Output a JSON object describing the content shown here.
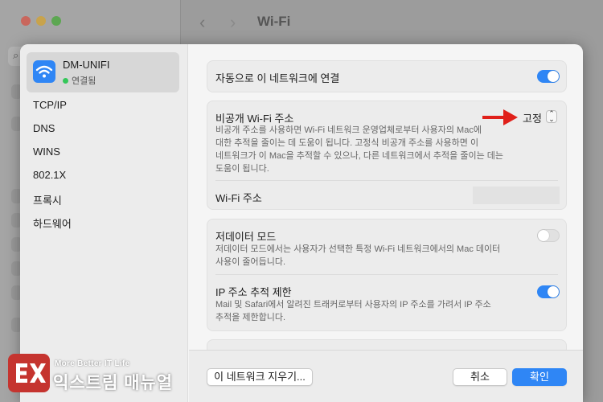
{
  "window": {
    "title": "Wi-Fi"
  },
  "sidebar": {
    "network": {
      "name": "DM-UNIFI",
      "status": "연결됨"
    },
    "items": [
      "TCP/IP",
      "DNS",
      "WINS",
      "802.1X",
      "프록시",
      "하드웨어"
    ]
  },
  "settings": {
    "auto_join": {
      "label": "자동으로 이 네트워크에 연결",
      "enabled": true
    },
    "private_address": {
      "label": "비공개 Wi-Fi 주소",
      "value": "고정",
      "description_lines": [
        "비공개 주소를 사용하면 Wi-Fi 네트워크 운영업체로부터 사용자의 Mac에",
        "대한 추적을 줄이는 데 도움이 됩니다. 고정식 비공개 주소를 사용하면 이",
        "네트워크가 이 Mac을 추적할 수 있으나, 다른 네트워크에서 추적을 줄이는 데는",
        "도움이 됩니다."
      ]
    },
    "wifi_address": {
      "label": "Wi-Fi 주소"
    },
    "low_data": {
      "label": "저데이터 모드",
      "enabled": false,
      "description_lines": [
        "저데이터 모드에서는 사용자가 선택한 특정 Wi-Fi 네트워크에서의 Mac 데이터",
        "사용이 줄어듭니다."
      ]
    },
    "limit_ip_tracking": {
      "label": "IP 주소 추적 제한",
      "enabled": true,
      "description_lines": [
        "Mail 및 Safari에서 알려진 트래커로부터 사용자의 IP 주소를 가려서 IP 주소",
        "추적을 제한합니다."
      ]
    }
  },
  "footer": {
    "forget_label": "이 네트워크 지우기...",
    "cancel_label": "취소",
    "ok_label": "확인"
  },
  "watermark": {
    "tagline": "More Better IT Life",
    "name": "익스트림 매뉴얼"
  },
  "colors": {
    "accent": "#2f86f5",
    "arrow": "#e0201a",
    "logo": "#c5342f"
  }
}
